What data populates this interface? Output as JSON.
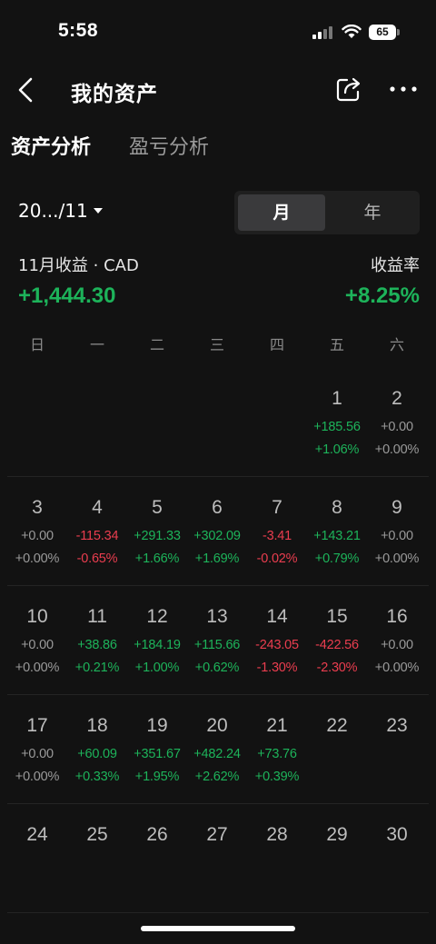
{
  "status": {
    "time": "5:58",
    "battery": "65"
  },
  "header": {
    "title": "我的资产"
  },
  "tabs": [
    {
      "label": "资产分析"
    },
    {
      "label": "盈亏分析"
    }
  ],
  "period": {
    "label": "20.../11"
  },
  "toggle": {
    "month": "月",
    "year": "年"
  },
  "summary": {
    "label": "11月收益 · CAD",
    "value": "+1,444.30",
    "rate_label": "收益率",
    "rate_value": "+8.25%"
  },
  "weekdays": [
    "日",
    "一",
    "二",
    "三",
    "四",
    "五",
    "六"
  ],
  "weeks": [
    [
      {
        "day": "",
        "amt": "",
        "pct": "",
        "tone": "zero"
      },
      {
        "day": "",
        "amt": "",
        "pct": "",
        "tone": "zero"
      },
      {
        "day": "",
        "amt": "",
        "pct": "",
        "tone": "zero"
      },
      {
        "day": "",
        "amt": "",
        "pct": "",
        "tone": "zero"
      },
      {
        "day": "",
        "amt": "",
        "pct": "",
        "tone": "zero"
      },
      {
        "day": "1",
        "amt": "+185.56",
        "pct": "+1.06%",
        "tone": "pos"
      },
      {
        "day": "2",
        "amt": "+0.00",
        "pct": "+0.00%",
        "tone": "zero"
      }
    ],
    [
      {
        "day": "3",
        "amt": "+0.00",
        "pct": "+0.00%",
        "tone": "zero"
      },
      {
        "day": "4",
        "amt": "-115.34",
        "pct": "-0.65%",
        "tone": "neg"
      },
      {
        "day": "5",
        "amt": "+291.33",
        "pct": "+1.66%",
        "tone": "pos"
      },
      {
        "day": "6",
        "amt": "+302.09",
        "pct": "+1.69%",
        "tone": "pos"
      },
      {
        "day": "7",
        "amt": "-3.41",
        "pct": "-0.02%",
        "tone": "neg"
      },
      {
        "day": "8",
        "amt": "+143.21",
        "pct": "+0.79%",
        "tone": "pos"
      },
      {
        "day": "9",
        "amt": "+0.00",
        "pct": "+0.00%",
        "tone": "zero"
      }
    ],
    [
      {
        "day": "10",
        "amt": "+0.00",
        "pct": "+0.00%",
        "tone": "zero"
      },
      {
        "day": "11",
        "amt": "+38.86",
        "pct": "+0.21%",
        "tone": "pos"
      },
      {
        "day": "12",
        "amt": "+184.19",
        "pct": "+1.00%",
        "tone": "pos"
      },
      {
        "day": "13",
        "amt": "+115.66",
        "pct": "+0.62%",
        "tone": "pos"
      },
      {
        "day": "14",
        "amt": "-243.05",
        "pct": "-1.30%",
        "tone": "neg"
      },
      {
        "day": "15",
        "amt": "-422.56",
        "pct": "-2.30%",
        "tone": "neg"
      },
      {
        "day": "16",
        "amt": "+0.00",
        "pct": "+0.00%",
        "tone": "zero"
      }
    ],
    [
      {
        "day": "17",
        "amt": "+0.00",
        "pct": "+0.00%",
        "tone": "zero"
      },
      {
        "day": "18",
        "amt": "+60.09",
        "pct": "+0.33%",
        "tone": "pos"
      },
      {
        "day": "19",
        "amt": "+351.67",
        "pct": "+1.95%",
        "tone": "pos"
      },
      {
        "day": "20",
        "amt": "+482.24",
        "pct": "+2.62%",
        "tone": "pos"
      },
      {
        "day": "21",
        "amt": "+73.76",
        "pct": "+0.39%",
        "tone": "pos"
      },
      {
        "day": "22",
        "amt": "",
        "pct": "",
        "tone": "zero"
      },
      {
        "day": "23",
        "amt": "",
        "pct": "",
        "tone": "zero"
      }
    ],
    [
      {
        "day": "24",
        "amt": "",
        "pct": "",
        "tone": "zero"
      },
      {
        "day": "25",
        "amt": "",
        "pct": "",
        "tone": "zero"
      },
      {
        "day": "26",
        "amt": "",
        "pct": "",
        "tone": "zero"
      },
      {
        "day": "27",
        "amt": "",
        "pct": "",
        "tone": "zero"
      },
      {
        "day": "28",
        "amt": "",
        "pct": "",
        "tone": "zero"
      },
      {
        "day": "29",
        "amt": "",
        "pct": "",
        "tone": "zero"
      },
      {
        "day": "30",
        "amt": "",
        "pct": "",
        "tone": "zero"
      }
    ]
  ],
  "colors": {
    "positive": "#1db35a",
    "negative": "#ea3d4f",
    "neutral": "#9a9a9a",
    "accent": "#ff8a2e"
  }
}
